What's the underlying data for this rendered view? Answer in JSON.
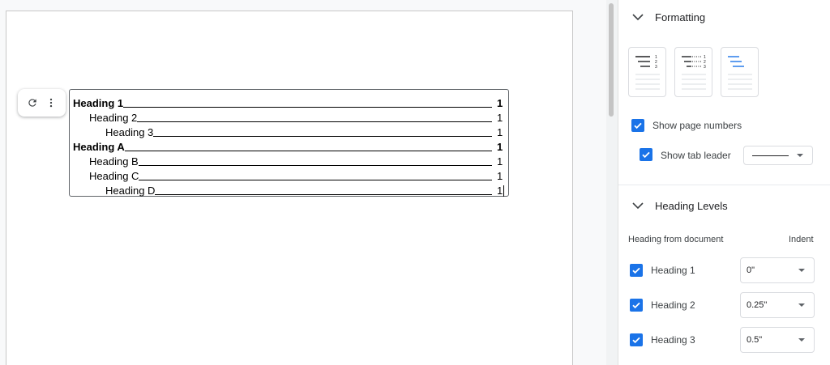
{
  "toc": {
    "entries": [
      {
        "text": "Heading 1",
        "page": "1",
        "level": 1,
        "bold": true
      },
      {
        "text": "Heading 2",
        "page": "1",
        "level": 2,
        "bold": false
      },
      {
        "text": "Heading 3",
        "page": "1",
        "level": 3,
        "bold": false
      },
      {
        "text": "Heading A",
        "page": "1",
        "level": 1,
        "bold": true
      },
      {
        "text": "Heading B",
        "page": "1",
        "level": 2,
        "bold": false
      },
      {
        "text": "Heading C",
        "page": "1",
        "level": 2,
        "bold": false
      },
      {
        "text": "Heading D",
        "page": "1",
        "level": 3,
        "bold": false
      }
    ],
    "toolbar_icons": [
      "refresh-icon",
      "more-vert-icon"
    ]
  },
  "panel": {
    "formatting": {
      "title": "Formatting",
      "styles": [
        "numbers-style",
        "dotted-style",
        "links-style"
      ],
      "show_page_numbers": {
        "label": "Show page numbers",
        "checked": true
      },
      "show_tab_leader": {
        "label": "Show tab leader",
        "checked": true
      }
    },
    "heading_levels": {
      "title": "Heading Levels",
      "col_source": "Heading from document",
      "col_indent": "Indent",
      "levels": [
        {
          "label": "Heading 1",
          "indent": "0\"",
          "checked": true
        },
        {
          "label": "Heading 2",
          "indent": "0.25\"",
          "checked": true
        },
        {
          "label": "Heading 3",
          "indent": "0.5\"",
          "checked": true
        }
      ]
    }
  },
  "colors": {
    "accent": "#1a73e8",
    "link": "#1a73e8"
  }
}
